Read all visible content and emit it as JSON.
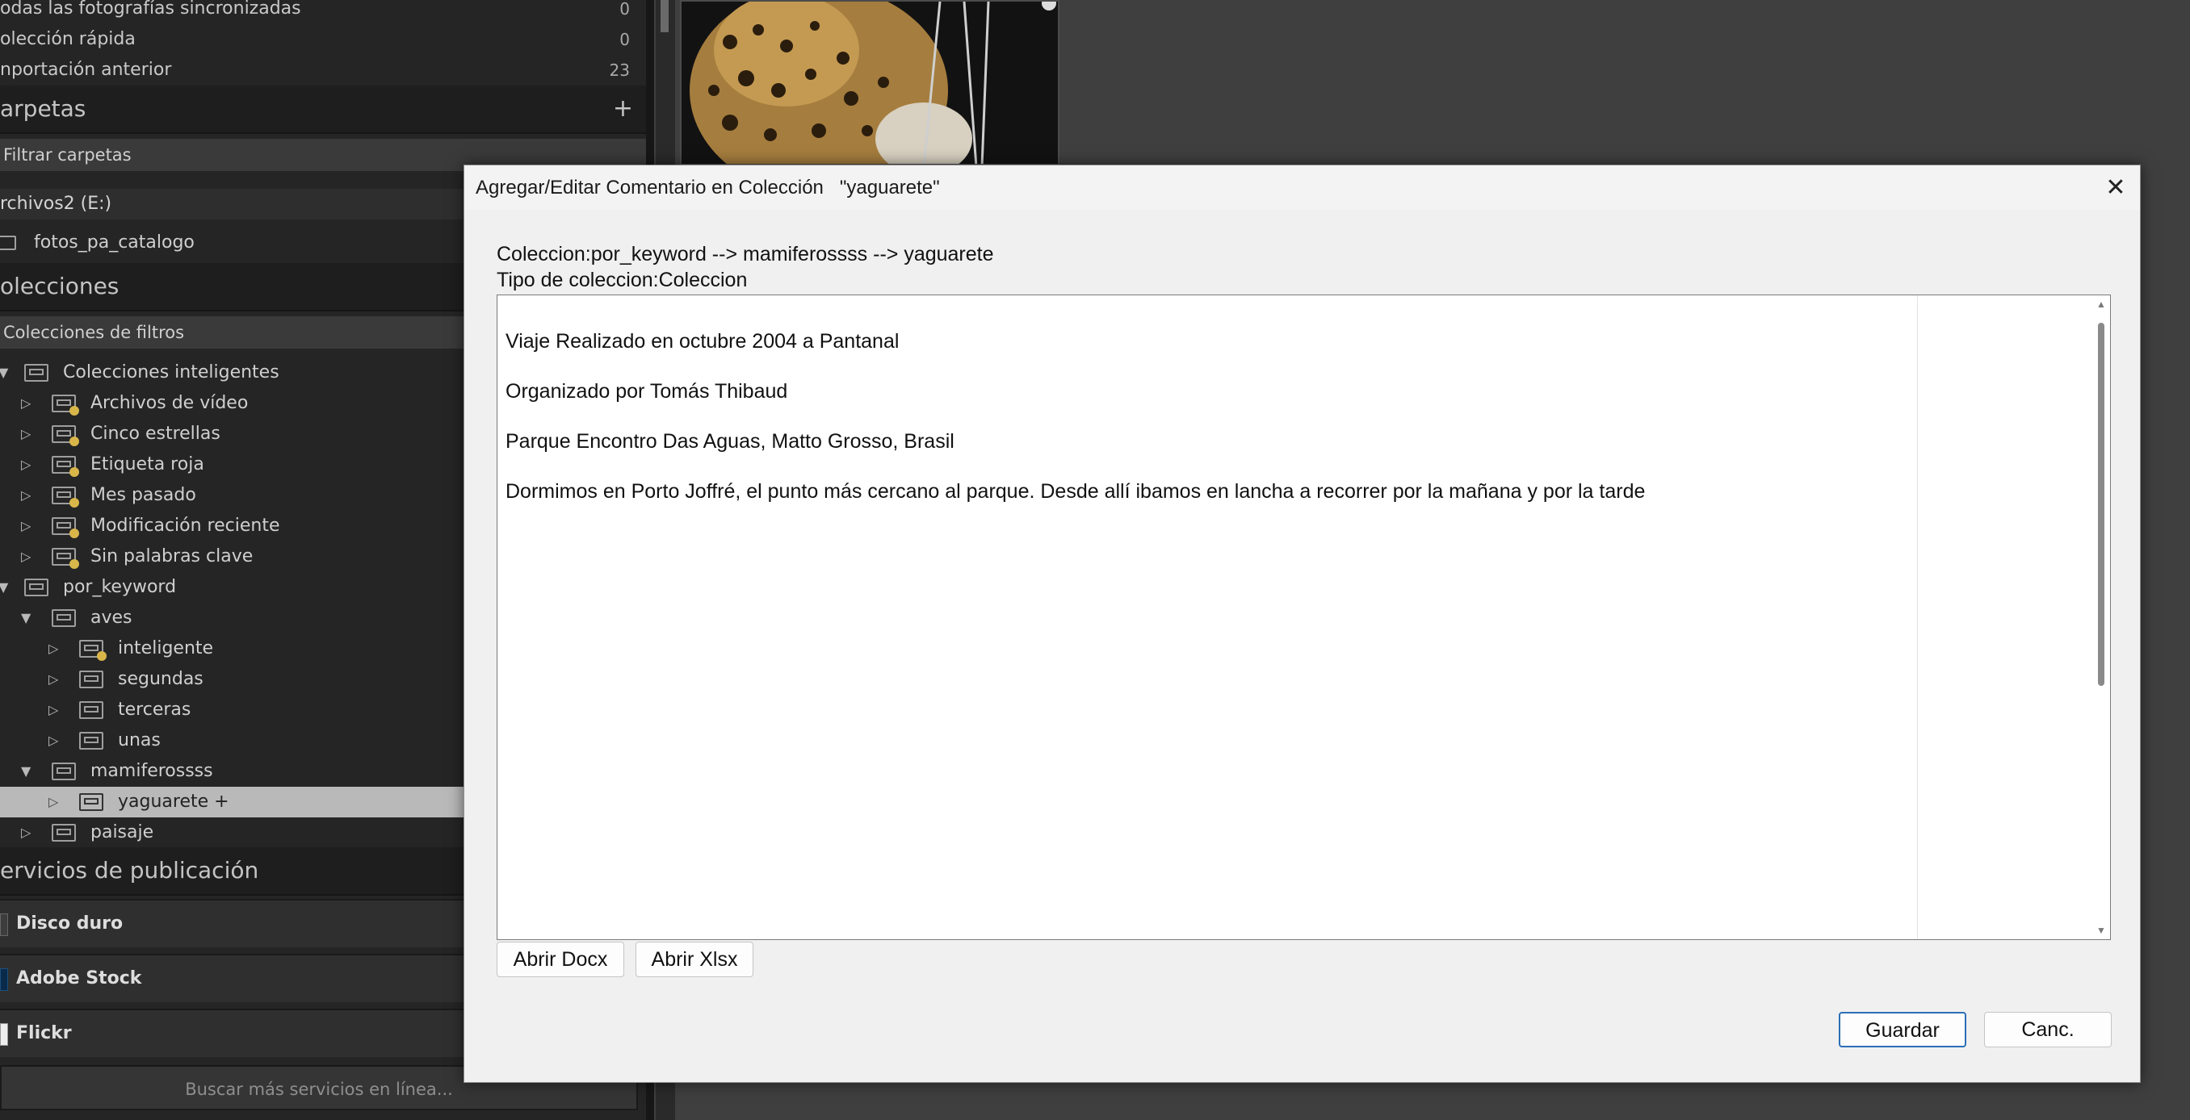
{
  "left_panel": {
    "catalog_rows": [
      {
        "label": "odas las fotografías sincronizadas",
        "count": "0"
      },
      {
        "label": "olección rápida",
        "count": "0"
      },
      {
        "label": "nportación anterior",
        "count": "23"
      }
    ],
    "folders_header": "arpetas",
    "folders_add": "+",
    "folder_filter": "Filtrar carpetas",
    "volume": "rchivos2 (E:)",
    "folder_item": "fotos_pa_catalogo",
    "collections_header": "olecciones",
    "collection_filter": "Colecciones de filtros",
    "tree": [
      {
        "label": "Colecciones inteligentes",
        "level": 0,
        "expanded": true,
        "type": "set"
      },
      {
        "label": "Archivos de vídeo",
        "level": 1,
        "expanded": false,
        "type": "smart"
      },
      {
        "label": "Cinco estrellas",
        "level": 1,
        "expanded": false,
        "type": "smart"
      },
      {
        "label": "Etiqueta roja",
        "level": 1,
        "expanded": false,
        "type": "smart"
      },
      {
        "label": "Mes pasado",
        "level": 1,
        "expanded": false,
        "type": "smart"
      },
      {
        "label": "Modificación reciente",
        "level": 1,
        "expanded": false,
        "type": "smart"
      },
      {
        "label": "Sin palabras clave",
        "level": 1,
        "expanded": false,
        "type": "smart"
      },
      {
        "label": "por_keyword",
        "level": 0,
        "expanded": true,
        "type": "set"
      },
      {
        "label": "aves",
        "level": 1,
        "expanded": true,
        "type": "set"
      },
      {
        "label": "inteligente",
        "level": 2,
        "expanded": false,
        "type": "smart"
      },
      {
        "label": "segundas",
        "level": 2,
        "expanded": false,
        "type": "collection"
      },
      {
        "label": "terceras",
        "level": 2,
        "expanded": false,
        "type": "collection"
      },
      {
        "label": "unas",
        "level": 2,
        "expanded": false,
        "type": "collection"
      },
      {
        "label": "mamiferossss",
        "level": 1,
        "expanded": true,
        "type": "set"
      },
      {
        "label": "yaguarete  +",
        "level": 2,
        "expanded": false,
        "type": "collection",
        "selected": true
      },
      {
        "label": "paisaje",
        "level": 1,
        "expanded": false,
        "type": "set"
      }
    ],
    "publish_header": "ervicios de publicación",
    "publish_services": [
      "Disco duro",
      "Adobe Stock",
      "Flickr"
    ],
    "find_more": "Buscar más servicios en línea..."
  },
  "dialog": {
    "title": "Agregar/Editar Comentario en Colección   \"yaguarete\"",
    "close_symbol": "✕",
    "path_line": "Coleccion:por_keyword --> mamiferossss --> yaguarete",
    "type_line": "Tipo de coleccion:Coleccion",
    "comment_lines": [
      "Viaje Realizado en octubre 2004 a Pantanal",
      "Organizado por Tomás Thibaud",
      "Parque Encontro Das Aguas, Matto Grosso, Brasil",
      "Dormimos en Porto Joffré, el punto más cercano al parque. Desde allí ibamos en lancha a recorrer por la mañana y por la tarde"
    ],
    "open_docx": "Abrir Docx",
    "open_xlsx": "Abrir Xlsx",
    "save": "Guardar",
    "cancel": "Canc."
  },
  "colors": {
    "panel_bg": "#252525",
    "selected_row": "#b9b9b9",
    "dialog_bg": "#f0f0f0",
    "primary_border": "#2a6fb7"
  }
}
